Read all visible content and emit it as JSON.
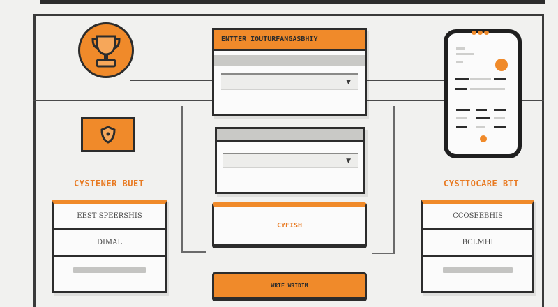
{
  "center_panel": {
    "title": "ENTTER IOUTURFANGASBHIY"
  },
  "left_side": {
    "label": "CYSTENER BUET",
    "rows": [
      {
        "label": "EEST SPEERSHIS"
      },
      {
        "label": "DIMAL"
      },
      {
        "label": ""
      }
    ]
  },
  "right_side": {
    "label": "CYSTTOCARE BTT",
    "rows": [
      {
        "label": "CCOSEEBHIS"
      },
      {
        "label": "BCLMHI"
      },
      {
        "label": ""
      }
    ]
  },
  "buttons": {
    "primary_label": "CYFISH",
    "secondary_label": "WRIE WRIDIM"
  },
  "icons": {
    "trophy": "trophy-icon",
    "shield": "shield-icon",
    "phone": "smartphone-icon"
  },
  "colors": {
    "accent": "#f08a2a",
    "ink": "#2c2c2c",
    "background": "#f1f1ef"
  }
}
